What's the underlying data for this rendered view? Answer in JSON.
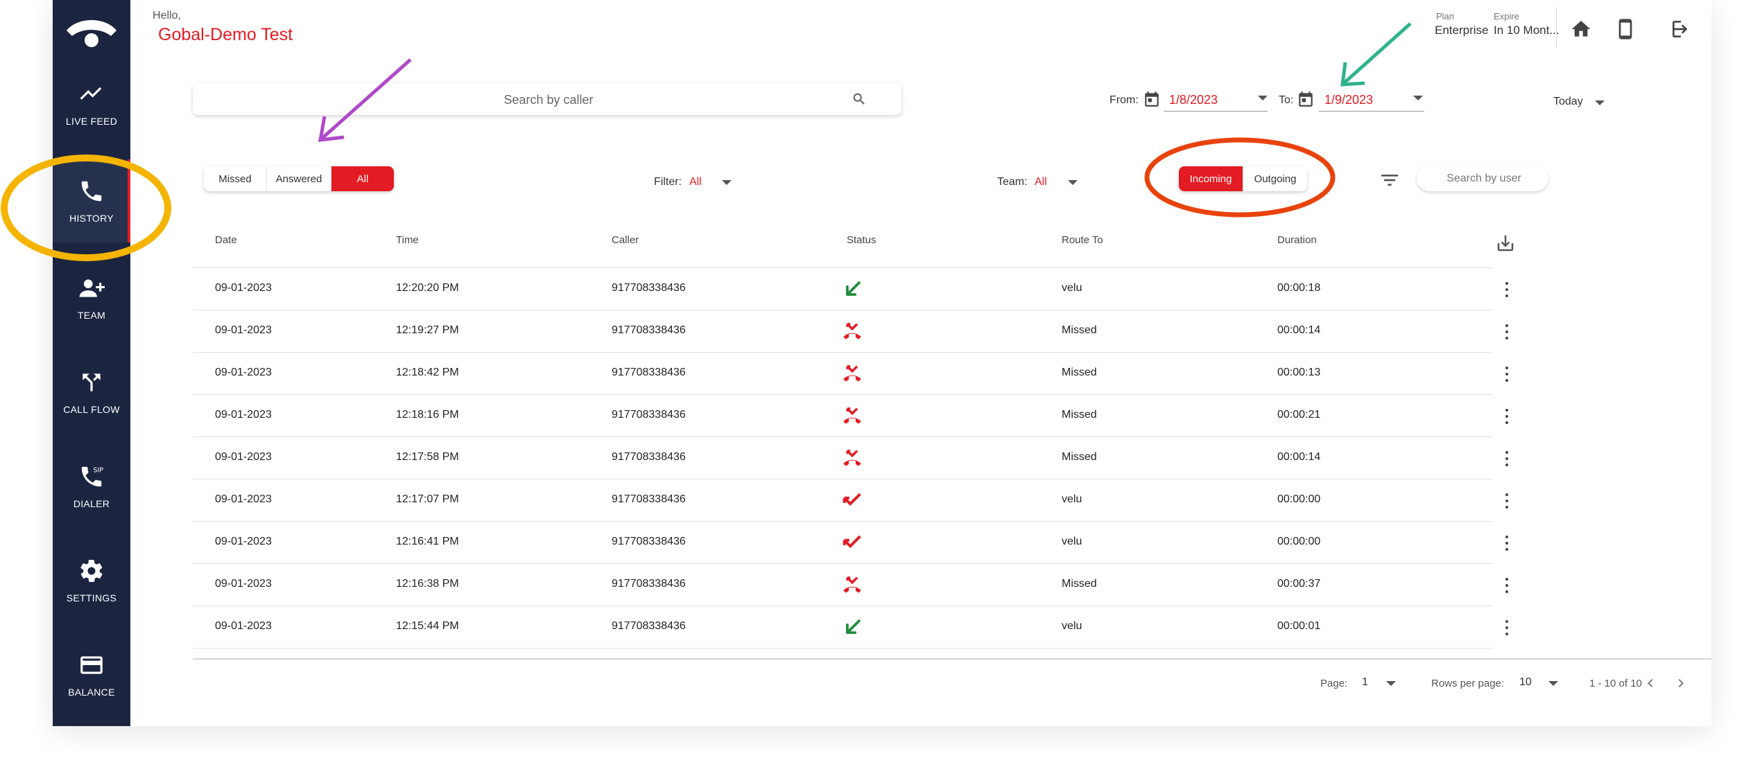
{
  "sidebar": {
    "items": [
      {
        "label": "LIVE FEED",
        "icon": "trend-icon"
      },
      {
        "label": "HISTORY",
        "icon": "phone-icon"
      },
      {
        "label": "TEAM",
        "icon": "add-user-icon"
      },
      {
        "label": "CALL FLOW",
        "icon": "call-split-icon"
      },
      {
        "label": "DIALER",
        "icon": "sip-phone-icon"
      },
      {
        "label": "SETTINGS",
        "icon": "gear-icon"
      },
      {
        "label": "BALANCE",
        "icon": "credit-card-icon"
      }
    ]
  },
  "header": {
    "greeting": "Hello,",
    "username": "Gobal-Demo Test",
    "plan_label": "Plan",
    "plan_value": "Enterprise",
    "expire_label": "Expire",
    "expire_value": "In 10 Mont..."
  },
  "search": {
    "placeholder": "Search by caller"
  },
  "dates": {
    "from_label": "From:",
    "from_value": "1/8/2023",
    "to_label": "To:",
    "to_value": "1/9/2023",
    "range": "Today"
  },
  "status_toggle": {
    "missed": "Missed",
    "answered": "Answered",
    "all": "All",
    "selected": "All"
  },
  "filter": {
    "label": "Filter:",
    "value": "All"
  },
  "team": {
    "label": "Team:",
    "value": "All"
  },
  "direction_toggle": {
    "incoming": "Incoming",
    "outgoing": "Outgoing",
    "selected": "Incoming"
  },
  "user_search": {
    "placeholder": "Search by user"
  },
  "table": {
    "headers": {
      "date": "Date",
      "time": "Time",
      "caller": "Caller",
      "status": "Status",
      "route": "Route To",
      "duration": "Duration"
    },
    "rows": [
      {
        "date": "09-01-2023",
        "time": "12:20:20 PM",
        "caller": "917708338436",
        "status": "answered",
        "route": "velu",
        "duration": "00:00:18"
      },
      {
        "date": "09-01-2023",
        "time": "12:19:27 PM",
        "caller": "917708338436",
        "status": "missed",
        "route": "Missed",
        "duration": "00:00:14"
      },
      {
        "date": "09-01-2023",
        "time": "12:18:42 PM",
        "caller": "917708338436",
        "status": "missed",
        "route": "Missed",
        "duration": "00:00:13"
      },
      {
        "date": "09-01-2023",
        "time": "12:18:16 PM",
        "caller": "917708338436",
        "status": "missed",
        "route": "Missed",
        "duration": "00:00:21"
      },
      {
        "date": "09-01-2023",
        "time": "12:17:58 PM",
        "caller": "917708338436",
        "status": "missed",
        "route": "Missed",
        "duration": "00:00:14"
      },
      {
        "date": "09-01-2023",
        "time": "12:17:07 PM",
        "caller": "917708338436",
        "status": "unanswered",
        "route": "velu",
        "duration": "00:00:00"
      },
      {
        "date": "09-01-2023",
        "time": "12:16:41 PM",
        "caller": "917708338436",
        "status": "unanswered",
        "route": "velu",
        "duration": "00:00:00"
      },
      {
        "date": "09-01-2023",
        "time": "12:16:38 PM",
        "caller": "917708338436",
        "status": "missed",
        "route": "Missed",
        "duration": "00:00:37"
      },
      {
        "date": "09-01-2023",
        "time": "12:15:44 PM",
        "caller": "917708338436",
        "status": "answered",
        "route": "velu",
        "duration": "00:00:01"
      }
    ]
  },
  "pagination": {
    "page_label": "Page:",
    "page_value": "1",
    "rows_label": "Rows per page:",
    "rows_value": "10",
    "range_text": "1 - 10 of 10"
  },
  "colors": {
    "sidebar_bg": "#1b2540",
    "accent_red": "#e31b23",
    "answered_green": "#1e8c3a",
    "annotation_yellow": "#f4b400",
    "annotation_orange": "#e8430c",
    "annotation_purple": "#b049c9",
    "annotation_teal": "#2fb38f"
  }
}
